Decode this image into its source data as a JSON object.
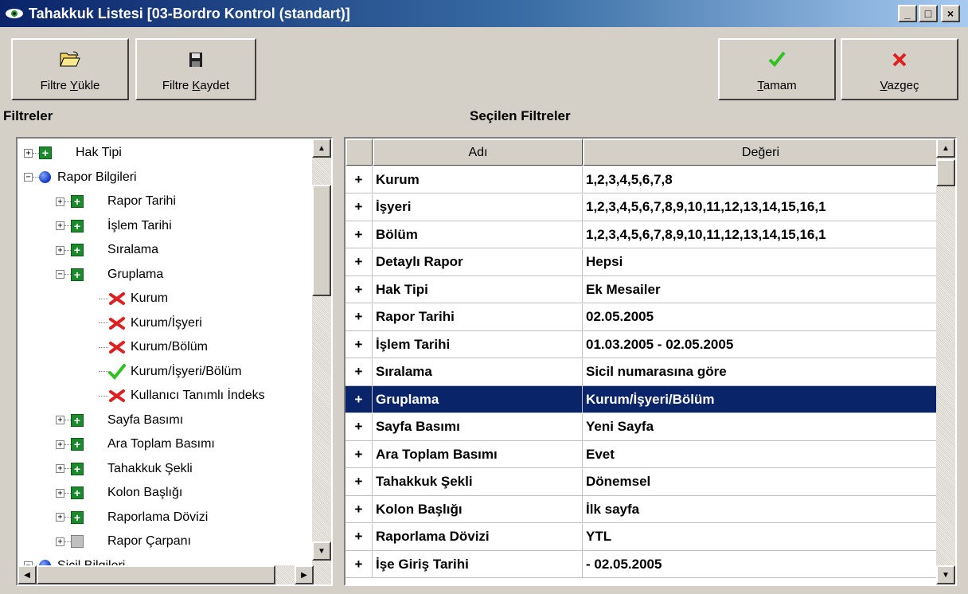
{
  "window": {
    "title": "Tahakkuk Listesi [03-Bordro Kontrol (standart)]",
    "icon": "eye-icon",
    "minimize": "_",
    "maximize": "□",
    "close": "×"
  },
  "toolbar": {
    "load_filter": {
      "pre": "Filtre ",
      "key": "Y",
      "post": "ükle",
      "icon": "open-folder-icon"
    },
    "save_filter": {
      "pre": "Filtre ",
      "key": "K",
      "post": "aydet",
      "icon": "floppy-disk-icon"
    },
    "ok": {
      "pre": "",
      "key": "T",
      "post": "amam",
      "icon": "green-check-icon"
    },
    "cancel": {
      "pre": "",
      "key": "V",
      "post": "azgeç",
      "icon": "red-x-icon"
    }
  },
  "labels": {
    "filters": "Filtreler",
    "selected_filters": "Seçilen Filtreler"
  },
  "tree": {
    "items": [
      {
        "label": "Hak Tipi",
        "icon": "green-plus-icon"
      },
      {
        "label": "Rapor Bilgileri",
        "icon": "blue-dot-icon"
      },
      {
        "label": "Rapor Tarihi",
        "icon": "green-plus-icon"
      },
      {
        "label": "İşlem Tarihi",
        "icon": "green-plus-icon"
      },
      {
        "label": "Sıralama",
        "icon": "green-plus-icon"
      },
      {
        "label": "Gruplama",
        "icon": "green-plus-icon"
      },
      {
        "label": "Kurum",
        "icon": "red-x-icon"
      },
      {
        "label": "Kurum/İşyeri",
        "icon": "red-x-icon"
      },
      {
        "label": "Kurum/Bölüm",
        "icon": "red-x-icon"
      },
      {
        "label": "Kurum/İşyeri/Bölüm",
        "icon": "green-check-icon"
      },
      {
        "label": "Kullanıcı Tanımlı İndeks",
        "icon": "red-x-icon"
      },
      {
        "label": "Sayfa Basımı",
        "icon": "green-plus-icon"
      },
      {
        "label": "Ara Toplam Basımı",
        "icon": "green-plus-icon"
      },
      {
        "label": "Tahakkuk Şekli",
        "icon": "green-plus-icon"
      },
      {
        "label": "Kolon Başlığı",
        "icon": "green-plus-icon"
      },
      {
        "label": "Raporlama Dövizi",
        "icon": "green-plus-icon"
      },
      {
        "label": "Rapor Çarpanı",
        "icon": "gray-box-icon"
      },
      {
        "label": "Sicil Bilgileri",
        "icon": "blue-dot-icon"
      }
    ]
  },
  "grid": {
    "columns": [
      "Adı",
      "Değeri"
    ],
    "row_marker": "+",
    "selected_row": "Gruplama",
    "rows": [
      {
        "name": "Kurum",
        "value": "1,2,3,4,5,6,7,8"
      },
      {
        "name": "İşyeri",
        "value": "1,2,3,4,5,6,7,8,9,10,11,12,13,14,15,16,1"
      },
      {
        "name": "Bölüm",
        "value": "1,2,3,4,5,6,7,8,9,10,11,12,13,14,15,16,1"
      },
      {
        "name": "Detaylı Rapor",
        "value": "Hepsi"
      },
      {
        "name": "Hak Tipi",
        "value": "Ek Mesailer"
      },
      {
        "name": "Rapor Tarihi",
        "value": "02.05.2005"
      },
      {
        "name": "İşlem Tarihi",
        "value": "01.03.2005 - 02.05.2005"
      },
      {
        "name": "Sıralama",
        "value": "Sicil numarasına göre"
      },
      {
        "name": "Gruplama",
        "value": "Kurum/İşyeri/Bölüm"
      },
      {
        "name": "Sayfa Basımı",
        "value": "Yeni Sayfa"
      },
      {
        "name": "Ara Toplam Basımı",
        "value": "Evet"
      },
      {
        "name": "Tahakkuk Şekli",
        "value": "Dönemsel"
      },
      {
        "name": "Kolon Başlığı",
        "value": "İlk sayfa"
      },
      {
        "name": "Raporlama Dövizi",
        "value": "YTL"
      },
      {
        "name": "İşe Giriş Tarihi",
        "value": " - 02.05.2005"
      }
    ]
  },
  "colors": {
    "title_bar": "#0a246a",
    "selection": "#0a246a",
    "face": "#d4d0c8",
    "icon_plus": "#1c8a2c",
    "icon_x": "#e02020",
    "icon_check": "#30c020"
  }
}
